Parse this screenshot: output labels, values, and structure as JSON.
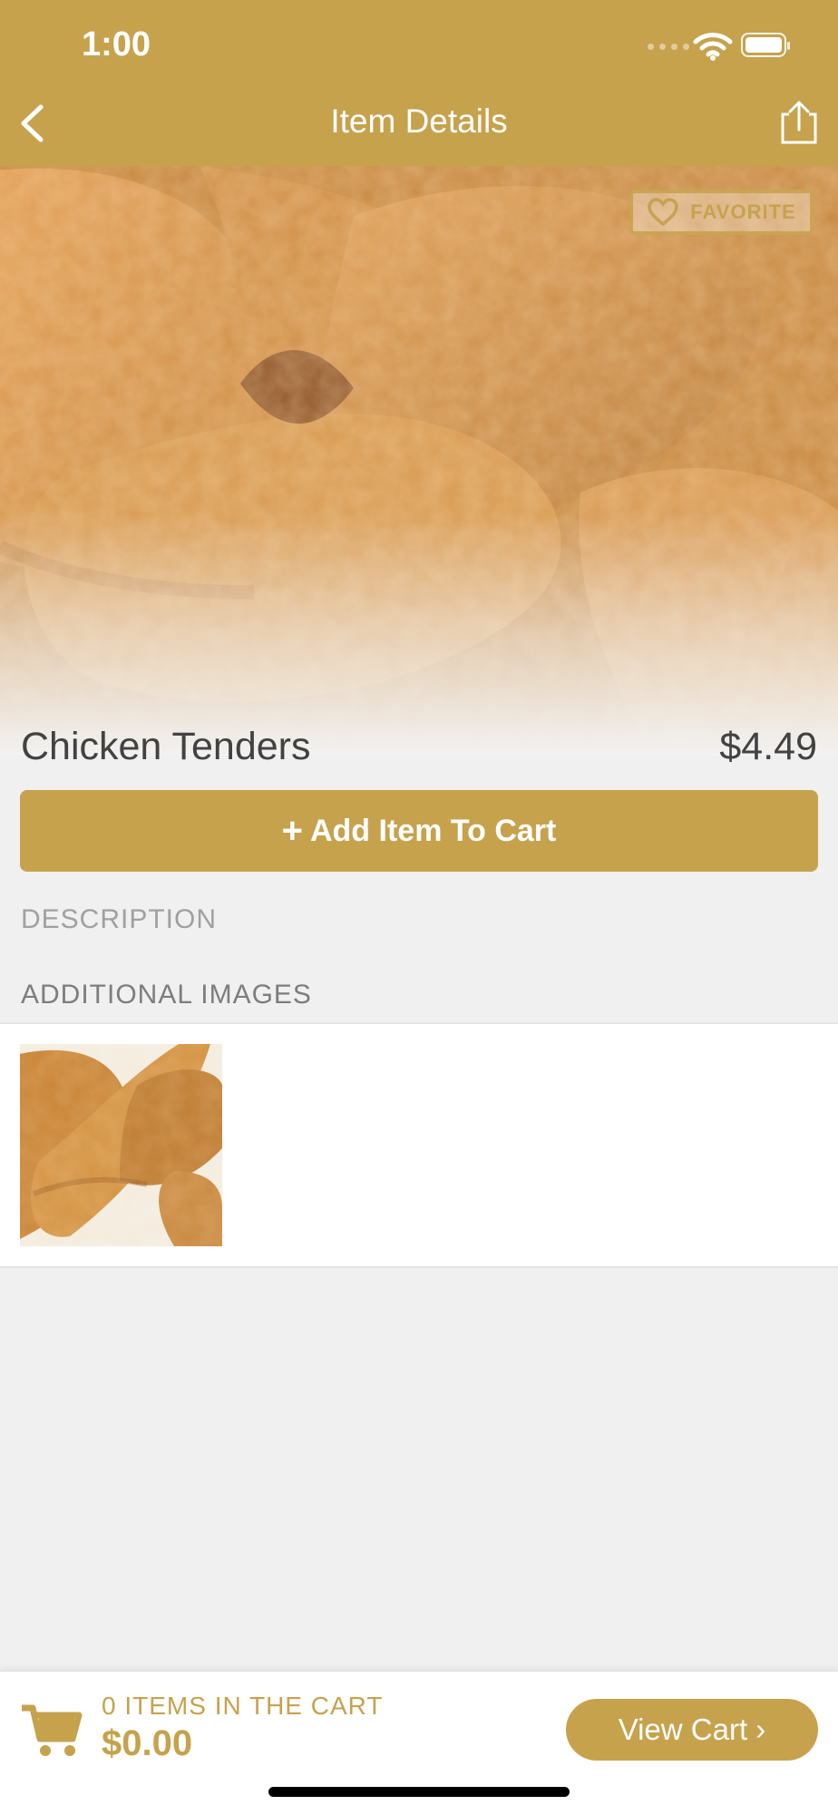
{
  "status_bar": {
    "time": "1:00"
  },
  "header": {
    "title": "Item Details",
    "back_icon": "chevron-left-icon",
    "share_icon": "share-icon"
  },
  "hero": {
    "favorite_label": "FAVORITE",
    "favorite_icon": "heart-icon"
  },
  "item": {
    "name": "Chicken Tenders",
    "price": "$4.49"
  },
  "actions": {
    "add_icon": "+",
    "add_label": "Add Item To Cart"
  },
  "sections": {
    "description_label": "DESCRIPTION",
    "additional_images_label": "ADDITIONAL IMAGES"
  },
  "cart": {
    "count_label": "0 ITEMS IN THE CART",
    "total": "$0.00",
    "view_cart_label": "View Cart ›",
    "cart_icon": "cart-icon"
  },
  "colors": {
    "accent": "#c6a24d",
    "text": "#424242",
    "background": "#f0f0f0"
  }
}
